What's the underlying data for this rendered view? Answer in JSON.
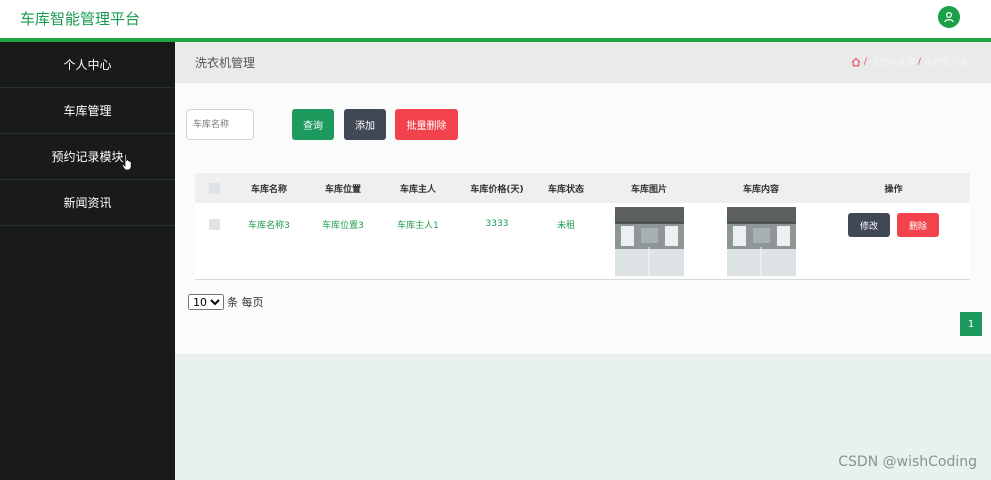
{
  "app": {
    "title": "车库智能管理平台"
  },
  "sidebar": {
    "items": [
      {
        "label": "个人中心"
      },
      {
        "label": "车库管理"
      },
      {
        "label": "预约记录模块"
      },
      {
        "label": "新闻资讯"
      }
    ]
  },
  "page": {
    "title": "洗衣机管理",
    "breadcrumb": [
      "洗衣机管理",
      "洗衣机列表"
    ]
  },
  "search": {
    "placeholder": "车库名称"
  },
  "toolbar": {
    "query_label": "查询",
    "add_label": "添加",
    "batch_delete_label": "批量删除"
  },
  "table": {
    "columns": [
      "车库名称",
      "车库位置",
      "车库主人",
      "车库价格(天)",
      "车库状态",
      "车库图片",
      "车库内容",
      "操作"
    ],
    "rows": [
      {
        "name": "车库名称3",
        "location": "车库位置3",
        "owner": "车库主人1",
        "price": "3333",
        "status": "未租",
        "edit_label": "修改",
        "delete_label": "删除"
      }
    ]
  },
  "pagination": {
    "page_size": "10",
    "page_size_options": [
      "10"
    ],
    "page_size_suffix": "条 每页",
    "current_page": "1"
  },
  "watermark": "CSDN @wishCoding",
  "colors": {
    "brand": "#1a9b50",
    "accent_line": "#20a446",
    "danger": "#f2434c",
    "dark_button": "#404755",
    "sidebar_bg": "#191b1a"
  },
  "icons": {
    "user": "user-icon",
    "home": "home-icon",
    "cursor": "hand-pointer-icon"
  }
}
